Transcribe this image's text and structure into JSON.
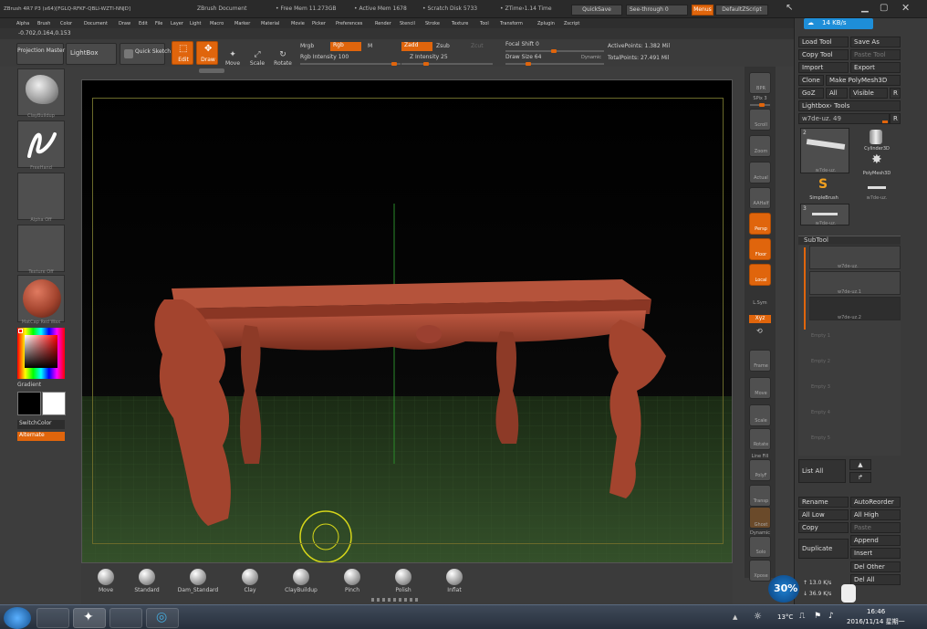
{
  "title_bar": {
    "app_info": "ZBrush 4R7 P3 (x64)[FGLQ-RFKF-QBLI-WZTI-NNJD]",
    "document": "ZBrush Document",
    "free_mem": "• Free Mem 11.273GB",
    "active_mem": "• Active Mem 1678",
    "scratch_disk": "• Scratch Disk 5733",
    "ztime": "• ZTime›1.14 Time",
    "quicksave": "QuickSave",
    "see_through": "See-through  0",
    "menus": "Menus",
    "default_script": "DefaultZScript"
  },
  "menu_items": [
    "Alpha",
    "Brush",
    "Color",
    "Document",
    "Draw",
    "Edit",
    "File",
    "Layer",
    "Light",
    "Macro",
    "Marker",
    "Material",
    "Movie",
    "Picker",
    "Preferences",
    "Render",
    "Stencil",
    "Stroke",
    "Texture",
    "Tool",
    "Transform",
    "Zplugin",
    "Zscript"
  ],
  "coords": "-0.702,0.164,0.153",
  "toolbar": {
    "projection_master": "Projection Master",
    "lightbox": "LightBox",
    "quick_sketch": "Quick Sketch",
    "edit": "Edit",
    "draw": "Draw",
    "move": "Move",
    "scale": "Scale",
    "rotate": "Rotate",
    "mrgb": "Mrgb",
    "rgb": "Rgb",
    "m": "M",
    "rgb_intensity": "Rgb Intensity 100",
    "zadd": "Zadd",
    "zsub": "Zsub",
    "zcut": "Zcut",
    "z_intensity": "Z Intensity 25",
    "focal_shift": "Focal Shift 0",
    "draw_size": "Draw Size 64",
    "dynamic": "Dynamic",
    "active_points": "ActivePoints: 1.382 Mil",
    "total_points": "TotalPoints: 27.491 Mil"
  },
  "left_shelf": {
    "brush": "ClayBuildup",
    "stroke": "FreeHand",
    "alpha": "Alpha Off",
    "texture": "Texture Off",
    "material": "MatCap Red Wax",
    "gradient": "Gradient",
    "switch_color": "SwitchColor",
    "alternate": "Alternate"
  },
  "right_shelf": [
    "BPR",
    "SPix 3",
    "Scroll",
    "Zoom",
    "Actual",
    "AAHalf",
    "Persp",
    "Floor",
    "Local",
    "L.Sym",
    "Xyz",
    "",
    "Frame",
    "Move",
    "Scale",
    "Rotate",
    "Line Fill",
    "PolyF",
    "Transp",
    "Ghost",
    "Dynamic",
    "Solo",
    "Xpose"
  ],
  "right_panel": {
    "net_speed": "14 KB/s",
    "load_tool": "Load Tool",
    "save_as": "Save As",
    "copy_tool": "Copy Tool",
    "paste_tool": "Paste Tool",
    "import": "Import",
    "export": "Export",
    "clone": "Clone",
    "make_polymesh": "Make PolyMesh3D",
    "goz": "GoZ",
    "all": "All",
    "visible": "Visible",
    "r": "R",
    "lightbox_tools": "Lightbox› Tools",
    "tool_name": "w7de-uz. 49",
    "tool_thumbs": [
      "w7de-uz.",
      "Cylinder3D",
      "PolyMesh3D",
      "SimpleBrush",
      "w7de-uz.",
      "w7de-uz."
    ],
    "thumb_counts": [
      "2",
      "3"
    ],
    "subtool": "SubTool",
    "subtool_items": [
      "w7de-uz.",
      "w7de-uz.1",
      "w7de-uz.2",
      "Empty 1",
      "Empty 2",
      "Empty 3",
      "Empty 4",
      "Empty 5",
      "Empty 6",
      "Empty 7"
    ],
    "list_all": "List All",
    "rename": "Rename",
    "auto_reorder": "AutoReorder",
    "all_low": "All Low",
    "all_high": "All High",
    "copy": "Copy",
    "paste": "Paste",
    "append": "Append",
    "duplicate": "Duplicate",
    "insert": "Insert",
    "del_other": "Del Other",
    "del_all": "Del All",
    "cpu_percent": "30%",
    "up_speed": "↑ 13.0 K/s",
    "down_speed": "↓ 36.9 K/s"
  },
  "brushes": [
    "Move",
    "Standard",
    "Dam_Standard",
    "Clay",
    "ClayBuildup",
    "Pinch",
    "Polish",
    "Inflat"
  ],
  "taskbar": {
    "temperature": "13°C",
    "time": "16:46",
    "date": "2016/11/14 星期一"
  },
  "colors": {
    "accent": "#e0650c",
    "model": "#a3442e",
    "floor_grid": "#2f4a25"
  }
}
